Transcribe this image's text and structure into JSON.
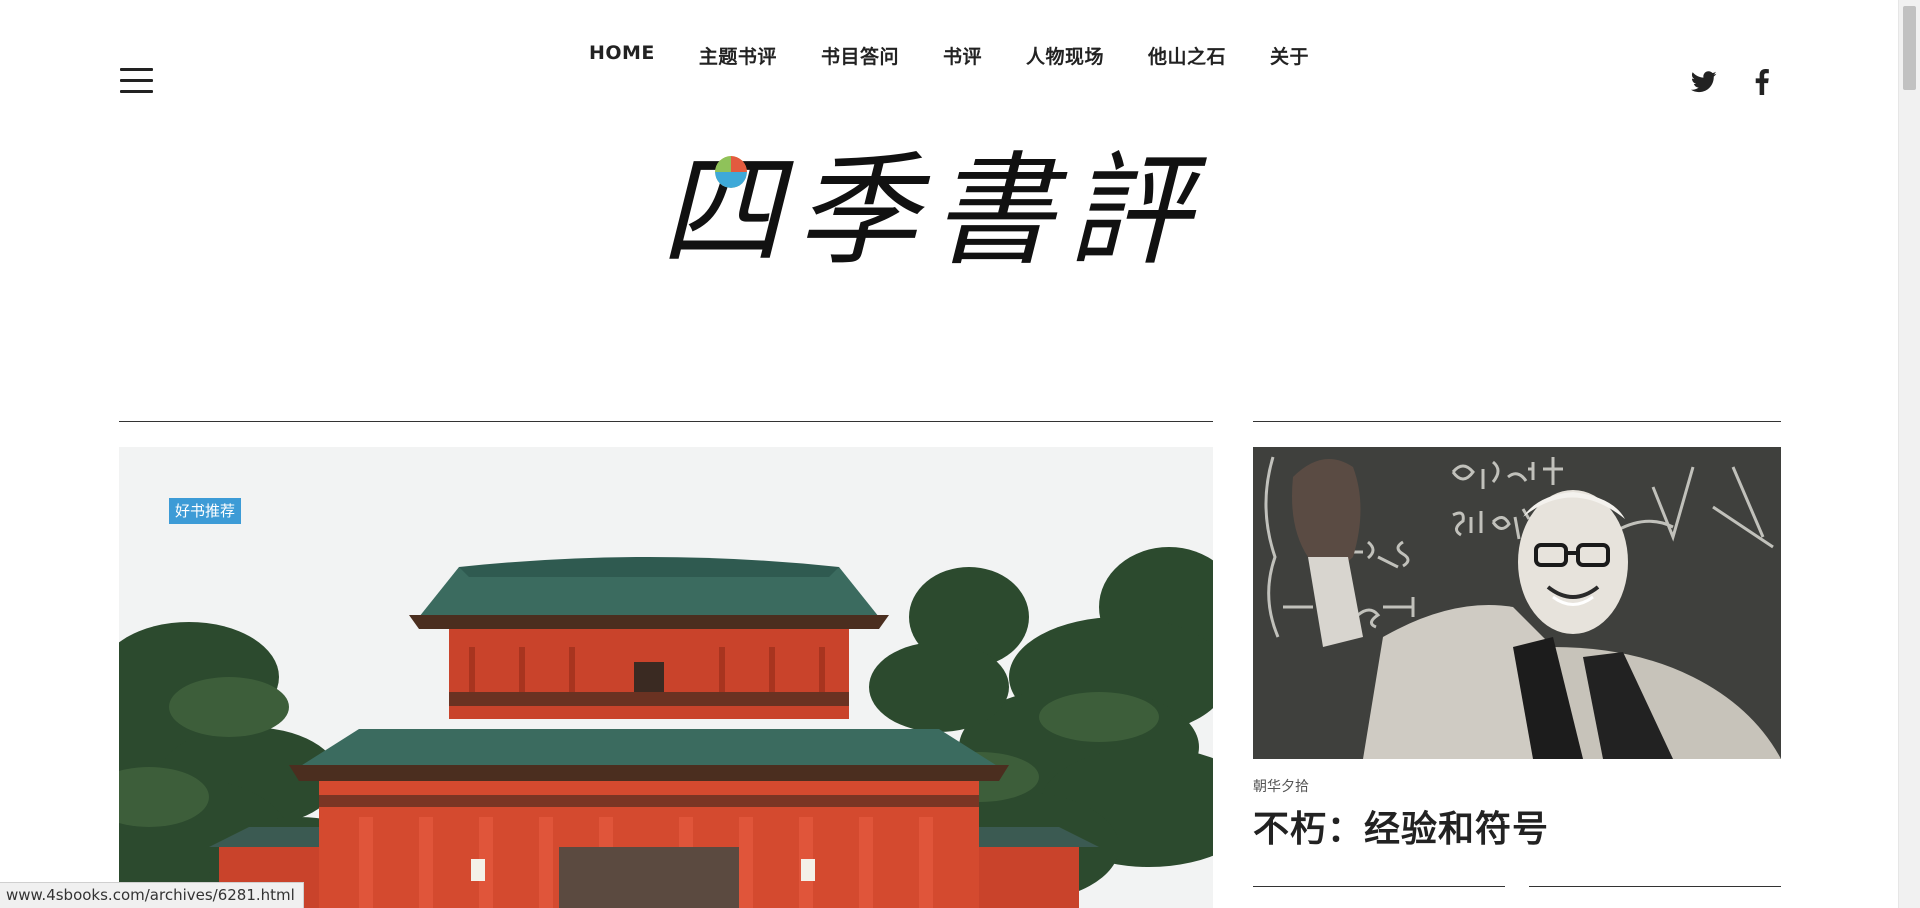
{
  "nav": {
    "items": [
      {
        "label": "HOME"
      },
      {
        "label": "主题书评"
      },
      {
        "label": "书目答问"
      },
      {
        "label": "书评"
      },
      {
        "label": "人物现场"
      },
      {
        "label": "他山之石"
      },
      {
        "label": "关于"
      }
    ]
  },
  "social": {
    "twitter_icon": "twitter-icon",
    "facebook_icon": "facebook-icon"
  },
  "logo": {
    "text": "四季書評"
  },
  "hero": {
    "category": "好书推荐"
  },
  "side_feature": {
    "category": "朝华夕拾",
    "title": "不朽：经验和符号"
  },
  "status_bar": {
    "url": "www.4sbooks.com/archives/6281.html"
  },
  "colors": {
    "accent": "#3d9bd6",
    "text": "#222222"
  }
}
